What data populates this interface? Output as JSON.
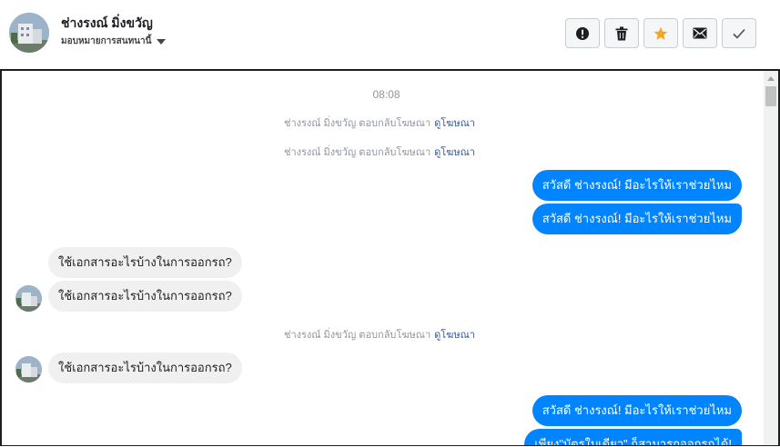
{
  "header": {
    "contact_name": "ช่างรงณ์ มิ่งขวัญ",
    "assign_label": "มอบหมายการสนทนานี้",
    "avatar_icon": "building-photo-avatar",
    "actions": {
      "spam_icon": "exclamation-circle-icon",
      "delete_icon": "trash-icon",
      "star_icon": "star-icon",
      "star_color": "#f5a623",
      "unread_icon": "envelope-icon",
      "done_icon": "checkmark-icon"
    }
  },
  "conversation": {
    "time": "08:08",
    "system_text": "ช่างรงณ์ มิ่งขวัญ ตอบกลับโฆษณา",
    "system_link": "ดูโฆษณา",
    "outgoing_color": "#0084ff",
    "messages": [
      {
        "type": "system",
        "text": "ช่างรงณ์ มิ่งขวัญ ตอบกลับโฆษณา",
        "link": "ดูโฆษณา"
      },
      {
        "type": "system",
        "text": "ช่างรงณ์ มิ่งขวัญ ตอบกลับโฆษณา",
        "link": "ดูโฆษณา"
      },
      {
        "type": "outgoing",
        "text": "สวัสดี ช่างรงณ์! มีอะไรให้เราช่วยไหม"
      },
      {
        "type": "outgoing",
        "text": "สวัสดี ช่างรงณ์! มีอะไรให้เราช่วยไหม"
      },
      {
        "type": "incoming",
        "text": "ใช้เอกสารอะไรบ้างในการออกรถ?"
      },
      {
        "type": "incoming",
        "text": "ใช้เอกสารอะไรบ้างในการออกรถ?"
      },
      {
        "type": "system",
        "text": "ช่างรงณ์ มิ่งขวัญ ตอบกลับโฆษณา",
        "link": "ดูโฆษณา"
      },
      {
        "type": "incoming",
        "text": "ใช้เอกสารอะไรบ้างในการออกรถ?"
      },
      {
        "type": "outgoing",
        "text": "สวัสดี ช่างรงณ์! มีอะไรให้เราช่วยไหม"
      },
      {
        "type": "outgoing",
        "text": "เพียง\"บัตรใบเดียว\" ก็สามารถออกรถได้!"
      }
    ]
  }
}
